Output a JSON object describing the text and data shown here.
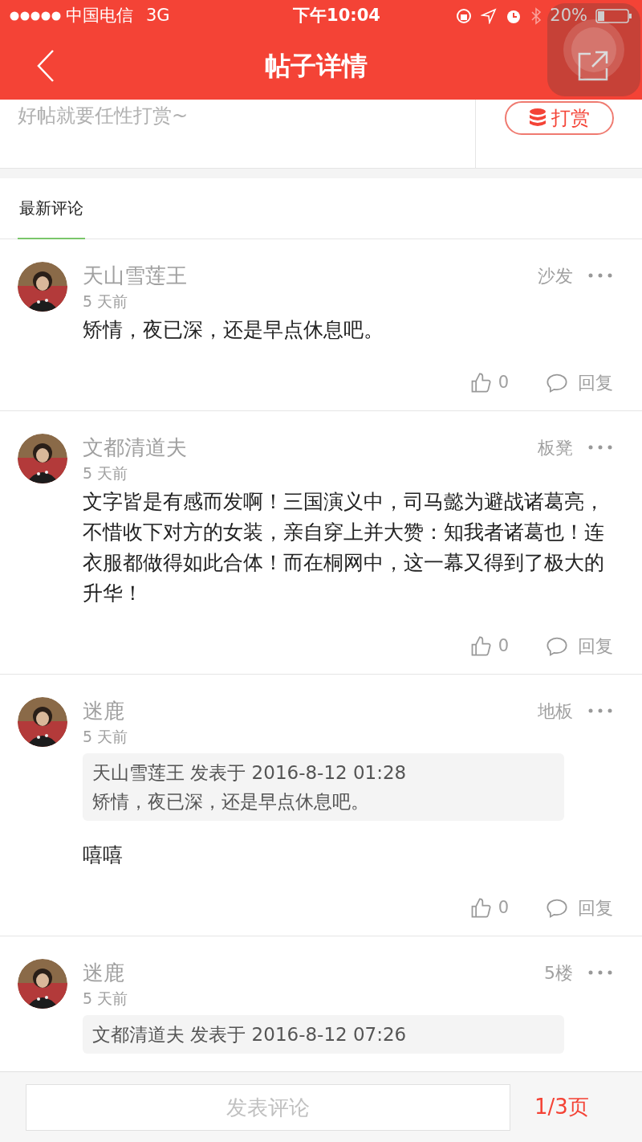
{
  "status_bar": {
    "carrier": "中国电信",
    "network": "3G",
    "time": "下午10:04",
    "battery": "20%"
  },
  "nav": {
    "title": "帖子详情"
  },
  "reward": {
    "prompt": "好帖就要任性打赏~",
    "button": "打赏"
  },
  "tabs": [
    {
      "label": "最新评论",
      "selected": true
    }
  ],
  "comments": [
    {
      "author": "天山雪莲王",
      "time": "5 天前",
      "floor": "沙发",
      "text": "矫情，夜已深，还是早点休息吧。",
      "likes": "0",
      "reply": "回复"
    },
    {
      "author": "文都清道夫",
      "time": "5 天前",
      "floor": "板凳",
      "text": "文字皆是有感而发啊！三国演义中，司马懿为避战诸葛亮，不惜收下对方的女装，亲自穿上并大赞：知我者诸葛也！连衣服都做得如此合体！而在桐网中，这一幕又得到了极大的升华！",
      "likes": "0",
      "reply": "回复"
    },
    {
      "author": "迷鹿",
      "time": "5 天前",
      "floor": "地板",
      "quote": {
        "header": "天山雪莲王 发表于 2016-8-12 01:28",
        "text": "矫情，夜已深，还是早点休息吧。"
      },
      "text": "嘻嘻",
      "likes": "0",
      "reply": "回复"
    },
    {
      "author": "迷鹿",
      "time": "5 天前",
      "floor": "5楼",
      "quote": {
        "header": "文都清道夫 发表于 2016-8-12 07:26"
      }
    }
  ],
  "bottom_bar": {
    "placeholder": "发表评论",
    "page": "1/3页"
  }
}
